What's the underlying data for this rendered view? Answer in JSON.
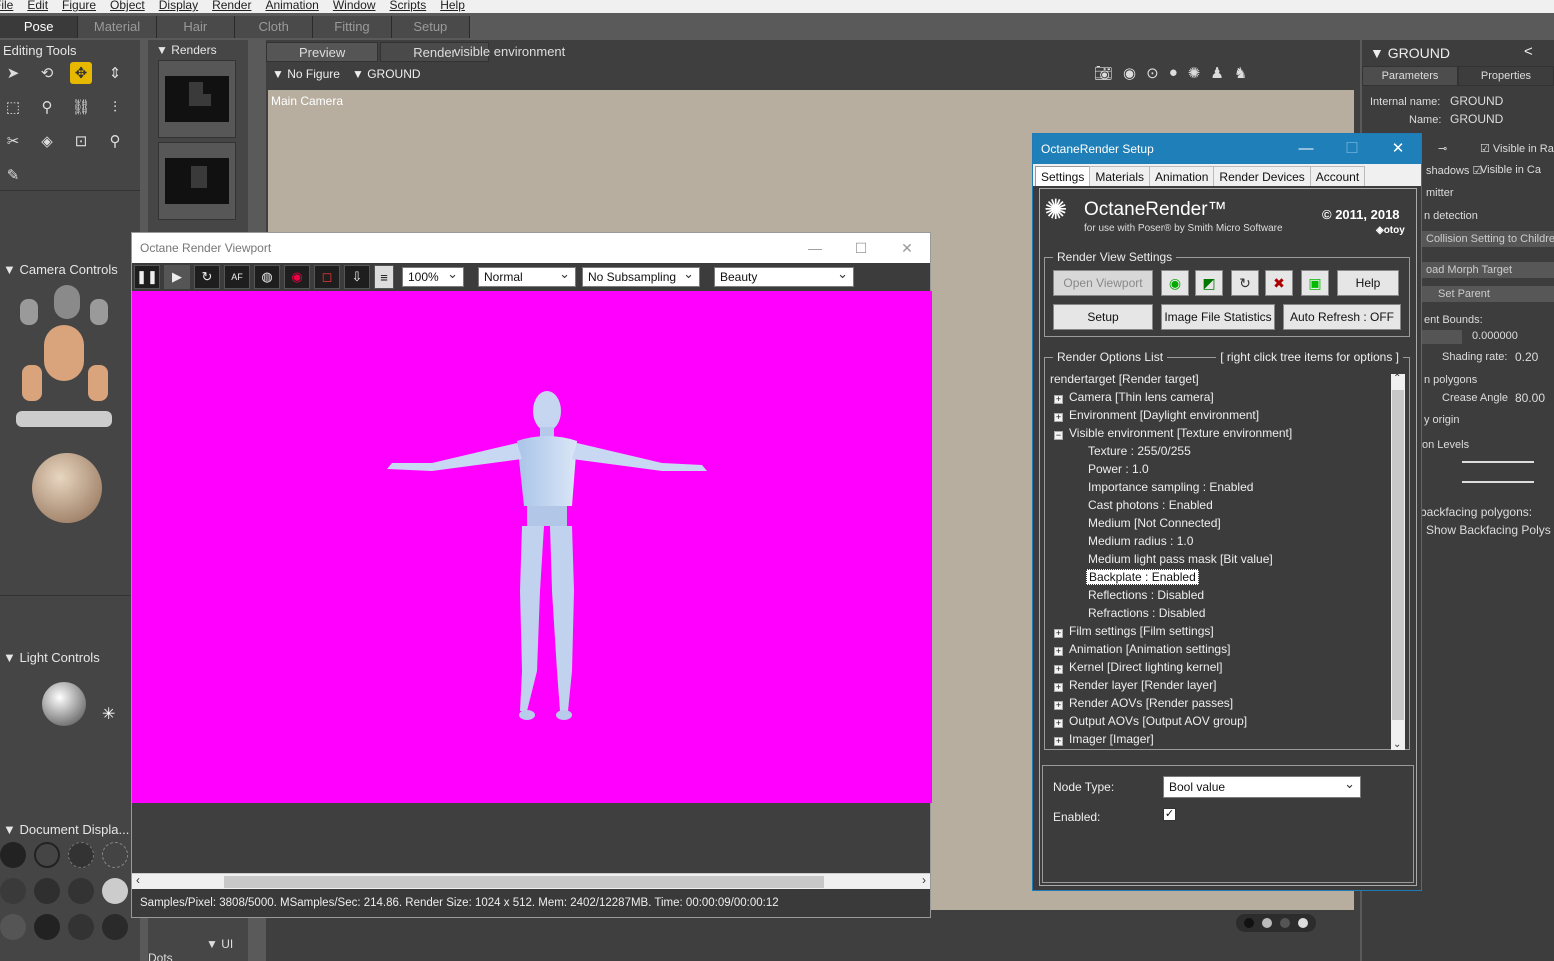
{
  "menu": [
    "File",
    "Edit",
    "Figure",
    "Object",
    "Display",
    "Render",
    "Animation",
    "Window",
    "Scripts",
    "Help"
  ],
  "rooms": [
    "Pose",
    "Material",
    "Hair",
    "Cloth",
    "Fitting",
    "Setup"
  ],
  "left_panel": {
    "editing_tools": "Editing Tools",
    "camera_controls": "Camera Controls",
    "light_controls": "Light Controls",
    "document_display": "Document Displa...",
    "ui_dots": "UI Dots"
  },
  "renders_panel": {
    "title": "Renders"
  },
  "document": {
    "tabs": [
      "Preview",
      "Render"
    ],
    "active_label": "visible environment",
    "figure_selector": "No Figure",
    "actor_selector": "GROUND",
    "camera_label": "Main Camera"
  },
  "right_panel": {
    "title": "GROUND",
    "tabs": [
      "Parameters",
      "Properties"
    ],
    "internal_name_label": "Internal name:",
    "internal_name": "GROUND",
    "name_label": "Name:",
    "name": "GROUND",
    "visible_in_ra": "Visible in Ra",
    "shadows": "shadows",
    "visible_in_ca": "Visible in Ca",
    "emitter": "mitter",
    "detection": "n detection",
    "collision_btn": "Collision Setting to Children",
    "morph_btn": "oad Morph Target",
    "parent_btn": "Set Parent",
    "bounds_label": "ent Bounds:",
    "bounds_value": "0.000000",
    "shading_label": "Shading rate:",
    "shading_value": "0.20",
    "polygons": "n polygons",
    "crease_label": "Crease Angle",
    "crease_value": "80.00",
    "origin": "y origin",
    "levels": "on Levels",
    "backfacing": "backfacing polygons:",
    "show_backfacing": "Show Backfacing Polys"
  },
  "octane_viewport": {
    "title": "Octane Render Viewport",
    "zoom": "100%",
    "mode": "Normal",
    "subsampling": "No Subsampling",
    "pass": "Beauty",
    "status": "Samples/Pixel: 3808/5000. MSamples/Sec: 214.86. Render Size: 1024 x 512. Mem: 2402/12287MB. Time: 00:00:09/00:00:12",
    "background_color": "#ff00ff"
  },
  "octane_setup": {
    "title": "OctaneRender Setup",
    "tabs": [
      "Settings",
      "Materials",
      "Animation",
      "Render Devices",
      "Account"
    ],
    "brand": "OctaneRender™",
    "brand_sub": "for use with Poser® by Smith Micro Software",
    "copyright": "© 2011, 2018",
    "otoy": "otoy",
    "render_view_settings": "Render View Settings",
    "open_viewport": "Open Viewport",
    "help": "Help",
    "setup": "Setup",
    "image_stats": "Image File Statistics",
    "auto_refresh": "Auto Refresh : OFF",
    "render_options_list": "Render Options List",
    "right_click_hint": "[ right click tree items for options ]",
    "tree": [
      "rendertarget   [Render target]",
      "Camera   [Thin lens camera]",
      "Environment   [Daylight environment]",
      "Visible environment   [Texture environment]",
      "Texture  :  255/0/255",
      "Power  :  1.0",
      "Importance sampling  :  Enabled",
      "Cast photons  :  Enabled",
      "Medium   [Not Connected]",
      "Medium radius  :  1.0",
      "Medium light pass mask   [Bit value]",
      "Backplate  :  Enabled",
      "Reflections  :  Disabled",
      "Refractions  :  Disabled",
      "Film settings   [Film settings]",
      "Animation   [Animation settings]",
      "Kernel   [Direct lighting kernel]",
      "Render layer   [Render layer]",
      "Render AOVs   [Render passes]",
      "Output AOVs   [Output AOV group]",
      "Imager   [Imager]"
    ],
    "node_type_label": "Node Type:",
    "node_type_value": "Bool value",
    "enabled_label": "Enabled:"
  }
}
